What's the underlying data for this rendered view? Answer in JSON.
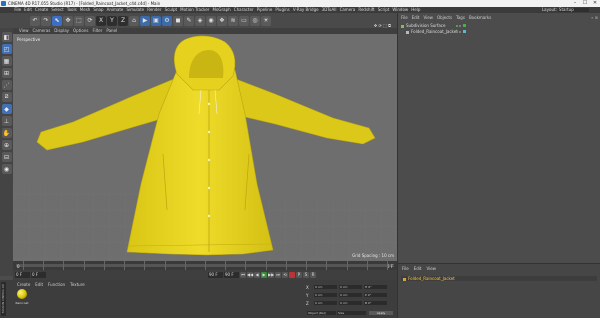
{
  "window": {
    "title": "CINEMA 4D R17.055 Studio (R17) - [Folded_Raincoat_Jacket_c4d.c4d] - Main",
    "controls": [
      "–",
      "☐",
      "✕"
    ]
  },
  "menubar": {
    "items": [
      "File",
      "Edit",
      "Create",
      "Select",
      "Tools",
      "Mesh",
      "Snap",
      "Animate",
      "Simulate",
      "Render",
      "Sculpt",
      "Motion Tracker",
      "MoGraph",
      "Character",
      "Pipeline",
      "Plugins",
      "V-Ray Bridge",
      "3DToAll",
      "Camera",
      "Redshift",
      "Script",
      "Window",
      "Help"
    ],
    "layout_label": "Layout:",
    "layout_value": "Startup"
  },
  "toolbar": {
    "icons": [
      "undo-icon",
      "redo-icon",
      "live-select-icon",
      "move-icon",
      "scale-icon",
      "rotate-icon",
      "x-axis-icon",
      "y-axis-icon",
      "z-axis-icon",
      "world-coord-icon",
      "render-view-icon",
      "render-picture-viewer-icon",
      "render-settings-icon",
      "cube-icon",
      "pen-icon",
      "subdivision-icon",
      "array-icon",
      "cloner-icon",
      "deformer-icon",
      "floor-icon",
      "camera-icon",
      "light-icon"
    ],
    "glyphs": [
      "↶",
      "↷",
      "⬉",
      "✥",
      "⬚",
      "⟳",
      "X",
      "Y",
      "Z",
      "⌂",
      "▶",
      "▣",
      "⚙",
      "◼",
      "✎",
      "◈",
      "◉",
      "❖",
      "≋",
      "▭",
      "◎",
      "☀"
    ]
  },
  "sidebar": {
    "icons": [
      "make-editable-icon",
      "model-mode-icon",
      "texture-mode-icon",
      "workplane-icon",
      "points-mode-icon",
      "edges-mode-icon",
      "polygons-mode-icon",
      "enable-axis-icon",
      "tweak-icon",
      "snap-icon",
      "lock-workplane-icon",
      "solo-icon"
    ],
    "glyphs": [
      "◧",
      "◰",
      "▦",
      "⊞",
      "⋰",
      "⧄",
      "◆",
      "⊥",
      "✋",
      "⊕",
      "⊟",
      "◉"
    ]
  },
  "viewport": {
    "menu": [
      "View",
      "Cameras",
      "Display",
      "Options",
      "Filter",
      "Panel"
    ],
    "label": "Perspective",
    "grid_spacing": "Grid Spacing : 10 cm",
    "nav_icons": "✥ ⟳ ⬚ ⧉"
  },
  "timeline": {
    "start_frame": "0",
    "end_frame": "0 F",
    "tick_labels": [
      "0",
      "5",
      "10",
      "15",
      "20",
      "25",
      "30",
      "35",
      "40",
      "45",
      "50",
      "55",
      "60",
      "65",
      "70",
      "75",
      "80",
      "85",
      "90"
    ]
  },
  "transport": {
    "current_frame": "0 F",
    "min_frame": "0 F",
    "max_frame": "90 F",
    "end_frame": "90 F",
    "buttons": [
      "⏮",
      "◀◀",
      "◀",
      "▶",
      "▶▶",
      "⏭",
      "⟲"
    ]
  },
  "material_manager": {
    "menu": [
      "Create",
      "Edit",
      "Function",
      "Texture"
    ],
    "material_name": "Raincoat",
    "vertical_brand": "MAXON CINEMA 4D"
  },
  "coordinates": {
    "rows": [
      {
        "axis": "X",
        "pos": "0 cm",
        "size": "0 cm",
        "rot": "H 0°"
      },
      {
        "axis": "Y",
        "pos": "0 cm",
        "size": "0 cm",
        "rot": "P 0°"
      },
      {
        "axis": "Z",
        "pos": "0 cm",
        "size": "0 cm",
        "rot": "B 0°"
      }
    ],
    "space": "Object (Rel)",
    "size_mode": "Size",
    "apply": "Apply"
  },
  "object_manager": {
    "menu": [
      "File",
      "Edit",
      "View",
      "Objects",
      "Tags",
      "Bookmarks"
    ],
    "objects": [
      {
        "name": "Subdivision Surface",
        "indent": 0
      },
      {
        "name": "Folded_Raincoat_Jacket",
        "indent": 1
      }
    ]
  },
  "attribute_manager": {
    "menu": [
      "File",
      "Edit",
      "View"
    ],
    "object_label": "Folded_Raincoat_Jacket"
  },
  "colors": {
    "coat": "#e7d21c",
    "viewport_bg": "#6e6e6e",
    "ui_bg": "#4c4c4c"
  }
}
